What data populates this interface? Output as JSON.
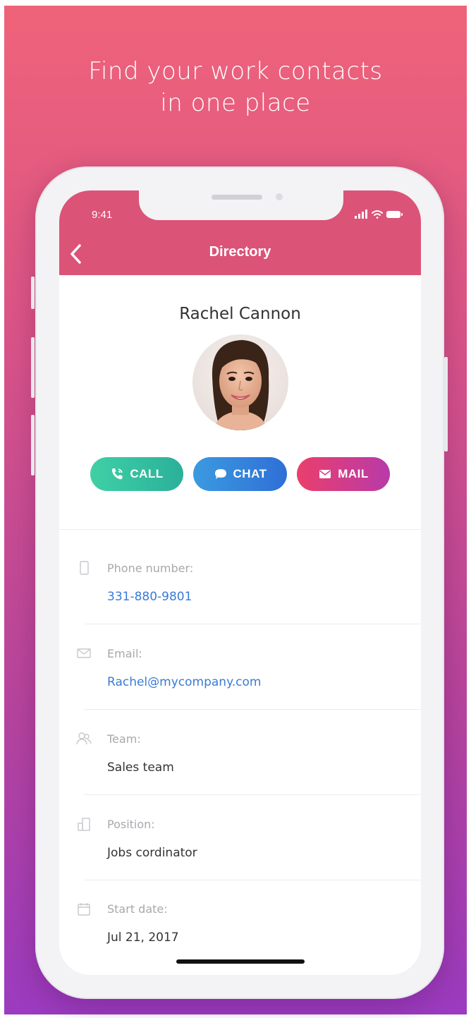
{
  "promo": {
    "headline_line1": "Find your work contacts",
    "headline_line2": "in one place"
  },
  "status_bar": {
    "time": "9:41",
    "icons": [
      "signal-icon",
      "wifi-icon",
      "battery-icon"
    ]
  },
  "header": {
    "title": "Directory",
    "back_icon": "chevron-left-icon",
    "color": "#dc5378"
  },
  "contact": {
    "name": "Rachel Cannon",
    "actions": [
      {
        "label": "CALL",
        "icon": "phone-icon",
        "color": "#34c3a0"
      },
      {
        "label": "CHAT",
        "icon": "chat-bubble-icon",
        "color": "#3587dc"
      },
      {
        "label": "MAIL",
        "icon": "envelope-icon",
        "color": "#d83d8a"
      }
    ]
  },
  "details": [
    {
      "label": "Phone number:",
      "value": "331-880-9801",
      "icon": "mobile-phone-icon"
    },
    {
      "label": "Email:",
      "value": "Rachel@mycompany.com",
      "icon": "envelope-outline-icon"
    },
    {
      "label": "Team:",
      "value": "Sales team",
      "icon": "team-icon"
    },
    {
      "label": "Position:",
      "value": "Jobs cordinator",
      "icon": "building-icon"
    },
    {
      "label": "Start date:",
      "value": "Jul 21, 2017",
      "icon": "calendar-icon"
    }
  ]
}
